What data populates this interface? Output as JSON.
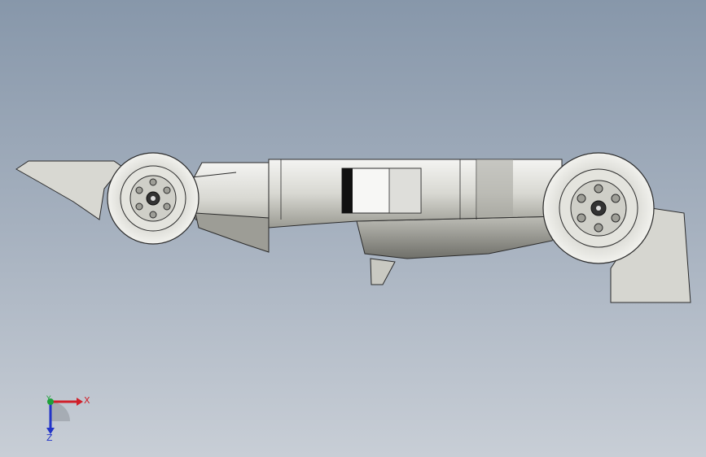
{
  "colors": {
    "viewport_top": "#8797aa",
    "viewport_bottom": "#c8ced6",
    "body_light": "#ececea",
    "body_mid": "#cfcfca",
    "body_dark": "#8e8e88",
    "outline": "#2b2b2b",
    "axis_x": "#d0202a",
    "axis_y": "#1ea13a",
    "axis_z": "#2234c8"
  },
  "triad": {
    "x_label": "X",
    "y_label": "Y",
    "z_label": "Z"
  },
  "model": {
    "view": "side-view-race-car-model"
  }
}
